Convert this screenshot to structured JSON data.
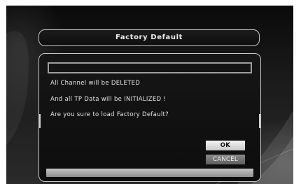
{
  "dialog": {
    "title": "Factory Default",
    "input_value": "",
    "messages": [
      "All Channel will be DELETED",
      "And all TP Data will be INITIALIZED !",
      "Are you sure to load Factory Default?"
    ],
    "buttons": {
      "ok_label": "OK",
      "cancel_label": "CANCEL"
    }
  },
  "colors": {
    "background": "#1a1a1a",
    "border": "#c8c8c8",
    "text": "#e6e6e6",
    "ok_button": "#e0e0e0",
    "cancel_button": "#707070"
  }
}
